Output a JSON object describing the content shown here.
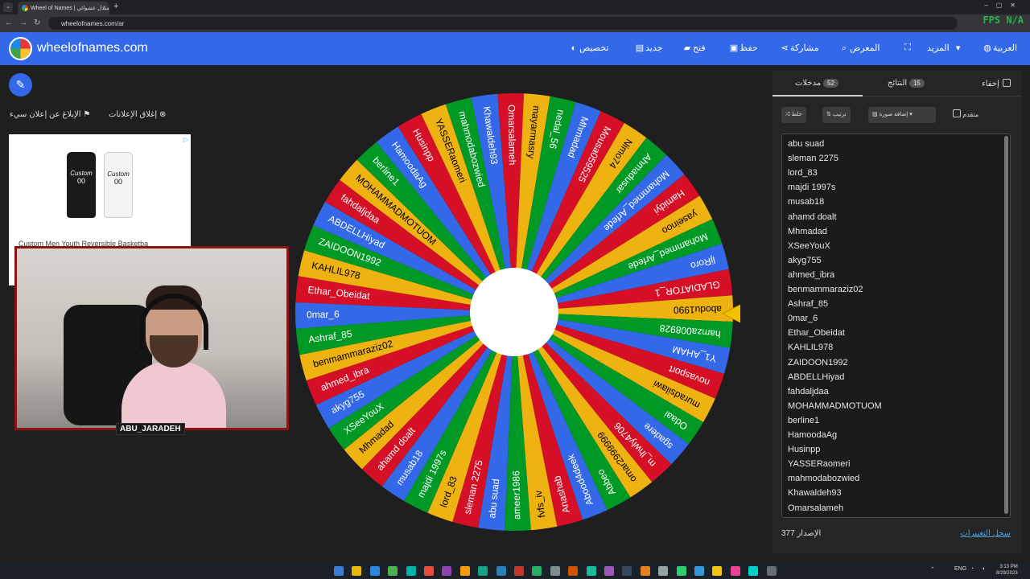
{
  "browser": {
    "tab_title": "Wheel of Names | مبدل عشوائي",
    "tab_close": "×",
    "new_tab": "+",
    "url": "wheelofnames.com/ar",
    "overlay": "FPS N/A"
  },
  "header": {
    "brand": "wheelofnames.com",
    "menu": [
      {
        "label": "تخصيص",
        "icon": "palette-icon",
        "glyph": "🎨"
      },
      {
        "label": "جديد",
        "icon": "file-icon",
        "glyph": "▤"
      },
      {
        "label": "فتح",
        "icon": "folder-icon",
        "glyph": "▰"
      },
      {
        "label": "حفظ",
        "icon": "save-icon",
        "glyph": "▣"
      },
      {
        "label": "مشاركة",
        "icon": "share-icon",
        "glyph": "⋖"
      },
      {
        "label": "المعرض",
        "icon": "search-icon",
        "glyph": "⌕"
      },
      {
        "label": "",
        "icon": "fullscreen-icon",
        "glyph": "⛶"
      },
      {
        "label": "المزيد",
        "icon": "chevron-down-icon",
        "glyph": "▾"
      },
      {
        "label": "العربية",
        "icon": "globe-icon",
        "glyph": "◍"
      }
    ]
  },
  "left": {
    "report_ad": "الإبلاغ عن إعلان سيء",
    "close_ads": "إغلاق الإعلانات",
    "ad_caption": "Custom Men Youth Reversible Basketba",
    "ad_jersey_text": "Custom",
    "ad_jersey_number": "00"
  },
  "webcam": {
    "name": "ABU_JARADEH"
  },
  "wheel": {
    "colors": [
      "#3369e8",
      "#d50f25",
      "#eeb211",
      "#009925"
    ],
    "pointer_color": "#f2c200",
    "names": [
      "abu suad",
      "sleman 2275",
      "lord_83",
      "majdi 1997s",
      "musab18",
      "ahamd doalt",
      "Mhmadad",
      "XSeeYouX",
      "akyg755",
      "ahmed_ibra",
      "benmammaraziz02",
      "Ashraf_85",
      "0mar_6",
      "Ethar_Obeidat",
      "KAHLIL978",
      "ZAIDOON1992",
      "ABDELLHiyad",
      "fahdaljdaa",
      "MOHAMMADMOTUOM",
      "berline1",
      "HamoodaAg",
      "Husinpp",
      "YASSERaomeri",
      "mahmodabozwied",
      "Khawaldeh93",
      "Omarsalameh",
      "mayarmasry",
      "nedal_56",
      "Mhmadad",
      "Mousa059525",
      "Nimo74",
      "Ahmadusar",
      "Mohammed_Arfede",
      "Hamidyi",
      "yaseinoo",
      "Mohammed_Arfede",
      "ljRoro",
      "GLADIATOR_1",
      "abodu1990",
      "hamza008928",
      "Y1_AHAM",
      "novasport",
      "muradsilawi",
      "Odaai",
      "sgadere",
      "m_lhwly4706",
      "omar2999999",
      "Abbeo",
      "Abood4deek",
      "Anashab",
      "fvfs_iv",
      "ameer1986"
    ]
  },
  "panel": {
    "tabs": {
      "entries_label": "مدخلات",
      "entries_count": "52",
      "results_label": "النتائج",
      "results_count": "15",
      "hide_label": "إخفاء"
    },
    "toolbar": {
      "shuffle": "خلط",
      "sort": "ترتيب",
      "add_image": "إضافة صورة",
      "advanced": "متقدم"
    },
    "entries": [
      "abu suad",
      "sleman 2275",
      "lord_83",
      "majdi 1997s",
      "musab18",
      "ahamd doalt",
      "Mhmadad",
      "XSeeYouX",
      "akyg755",
      "ahmed_ibra",
      "benmammaraziz02",
      "Ashraf_85",
      "0mar_6",
      "Ethar_Obeidat",
      "KAHLIL978",
      "ZAIDOON1992",
      "ABDELLHiyad",
      "fahdaljdaa",
      "MOHAMMADMOTUOM",
      "berline1",
      "HamoodaAg",
      "Husinpp",
      "YASSERaomeri",
      "mahmodabozwied",
      "Khawaldeh93",
      "Omarsalameh"
    ],
    "version_label": "الإصدار",
    "version_number": "377",
    "changelog": "سجل التغييرات"
  },
  "taskbar": {
    "lang": "ENG",
    "time": "3:13 PM",
    "date": "8/29/2023",
    "app_colors": [
      "#3a7bd5",
      "#e6b800",
      "#2e86de",
      "#4caf50",
      "#00b3a7",
      "#e74c3c",
      "#8e44ad",
      "#f39c12",
      "#16a085",
      "#2980b9",
      "#c0392b",
      "#27ae60",
      "#7f8c8d",
      "#d35400",
      "#1abc9c",
      "#9b59b6",
      "#34495e",
      "#e67e22",
      "#95a5a6",
      "#2ecc71",
      "#3498db",
      "#f1c40f",
      "#e84393",
      "#00cec9",
      "#636e72"
    ]
  }
}
